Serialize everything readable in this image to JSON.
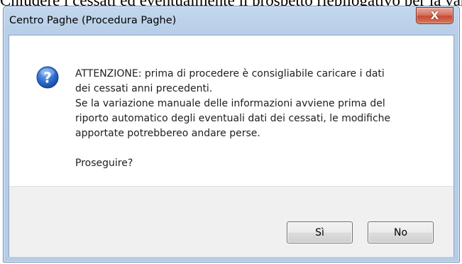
{
  "background": {
    "partial_text": "Chiudere i cessati ed eventualmente il prospetto riepilogativo per la variazione"
  },
  "dialog": {
    "title": "Centro Paghe (Procedura Paghe)",
    "close_glyph": "X",
    "icon": "question-icon",
    "message": {
      "line1": "ATTENZIONE: prima di procedere è consigliabile caricare i dati",
      "line2": "dei cessati anni precedenti.",
      "line3": "Se la variazione manuale delle informazioni avviene prima del",
      "line4": "riporto automatico degli eventuali dati dei cessati, le modifiche",
      "line5": "apportate potrebbereo andare perse.",
      "question": "Proseguire?"
    },
    "buttons": {
      "yes_label": "Sì",
      "no_label": "No"
    }
  },
  "colors": {
    "frame": "#b9cfe8",
    "close_button": "#c74a33",
    "icon_blue": "#2a63c4"
  }
}
